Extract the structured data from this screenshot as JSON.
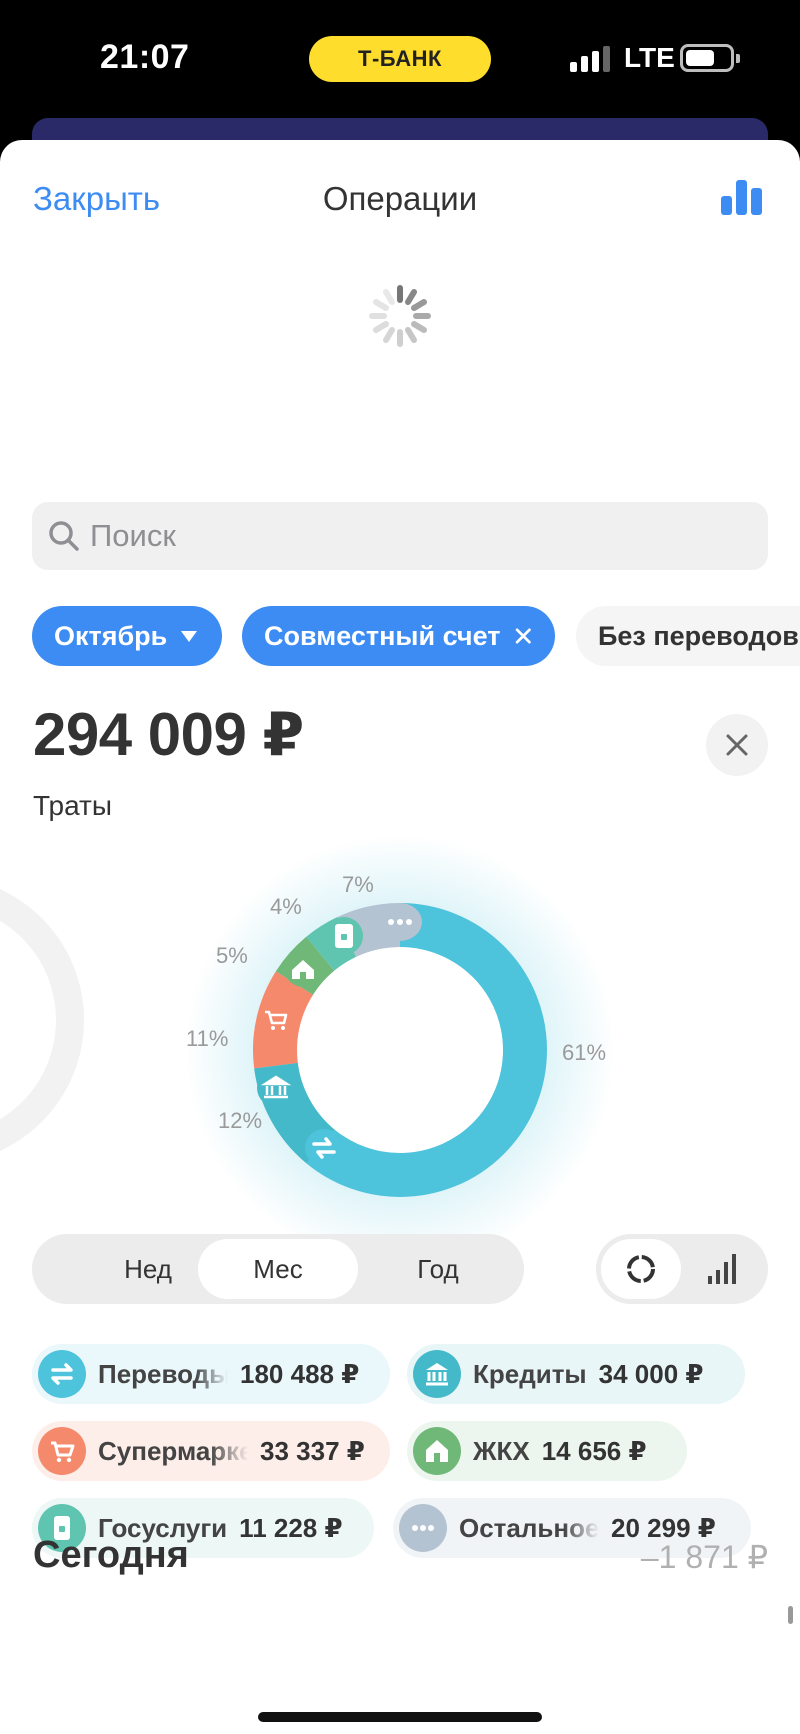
{
  "status_bar": {
    "time": "21:07",
    "carrier_pill": "Т-БАНК",
    "network": "LTE",
    "pill_color": "#ffdd2d"
  },
  "nav": {
    "close_label": "Закрыть",
    "title": "Операции",
    "chart_icon": "bar-chart-icon",
    "accent_color": "#3d8cf3"
  },
  "search": {
    "placeholder": "Поиск",
    "value": ""
  },
  "filters": {
    "month": "Октябрь",
    "account": "Совместный счет",
    "transfers": "Без переводов"
  },
  "summary": {
    "total": "294 009 ₽",
    "label": "Траты"
  },
  "donut_percents": {
    "transfers": "61%",
    "credits": "12%",
    "supermarkets": "11%",
    "housing": "5%",
    "gosuslugi": "4%",
    "other": "7%"
  },
  "period": {
    "week": "Нед",
    "month": "Мес",
    "year": "Год",
    "selected": "Мес"
  },
  "categories": [
    {
      "name": "Переводы",
      "amount": "180 488 ₽",
      "color": "#4ec3dc",
      "icon": "transfer-icon",
      "share": 0.61
    },
    {
      "name": "Кредиты",
      "amount": "34 000 ₽",
      "color": "#44b9c9",
      "icon": "bank-icon",
      "share": 0.12
    },
    {
      "name": "Супермаркеты",
      "amount": "33 337 ₽",
      "color": "#f5896c",
      "icon": "cart-icon",
      "share": 0.11
    },
    {
      "name": "ЖКХ",
      "amount": "14 656 ₽",
      "color": "#6fb878",
      "icon": "home-icon",
      "share": 0.05
    },
    {
      "name": "Госуслуги",
      "amount": "11 228 ₽",
      "color": "#5fc4b0",
      "icon": "document-icon",
      "share": 0.04
    },
    {
      "name": "Остальное",
      "amount": "20 299 ₽",
      "color": "#b3c3d2",
      "icon": "more-icon",
      "share": 0.07
    }
  ],
  "today": {
    "label": "Сегодня",
    "amount": "–1 871 ₽"
  }
}
